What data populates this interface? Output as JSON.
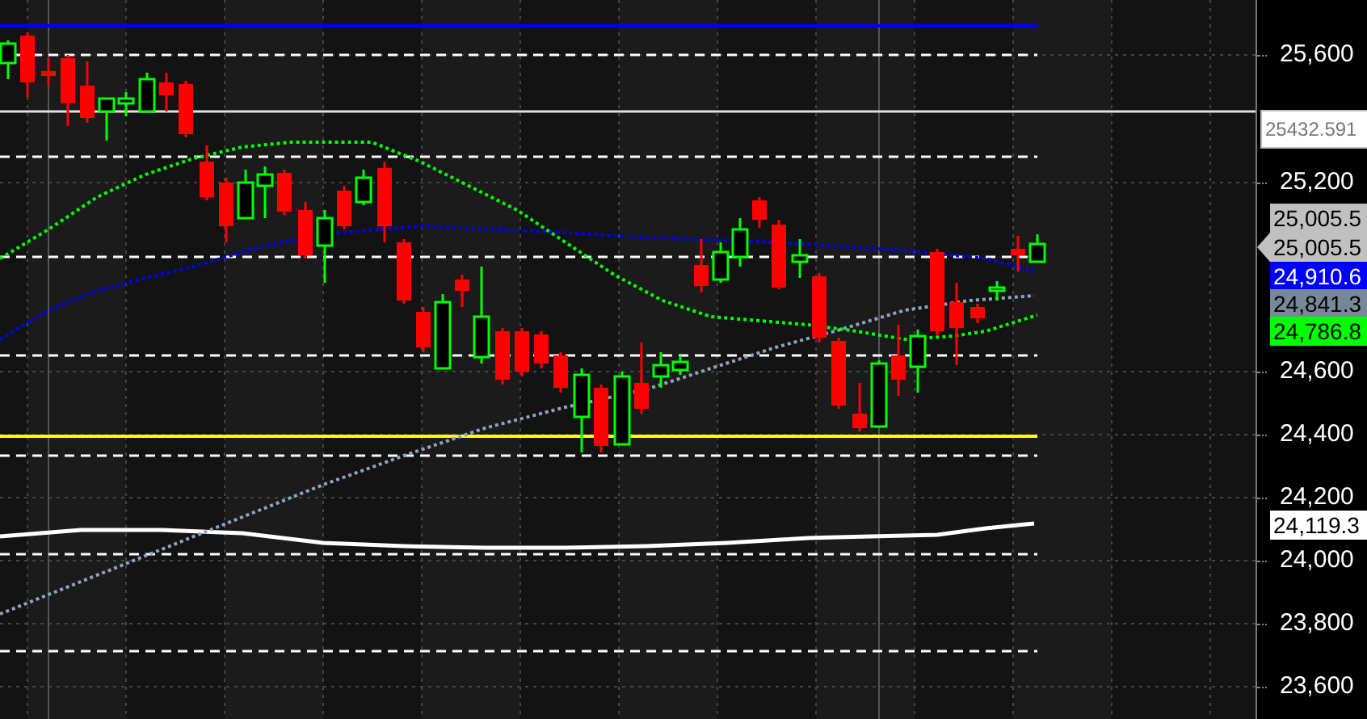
{
  "y_axis": {
    "ticks": [
      "25,600",
      "25,200",
      "24,600",
      "24,400",
      "24,200",
      "24,000",
      "23,800",
      "23,600"
    ]
  },
  "price_labels": [
    {
      "text": "25432.591",
      "color": "#ffffff",
      "kind": "line"
    },
    {
      "text": "25,005.5",
      "color": "#c0c0c0",
      "kind": "plain"
    },
    {
      "text": "25,005.5",
      "color": "#c0c0c0",
      "kind": "pointer"
    },
    {
      "text": "24,910.6",
      "color": "#0000ff",
      "kind": "plain"
    },
    {
      "text": "24,841.3",
      "color": "#778899",
      "kind": "plain"
    },
    {
      "text": "24,786.8",
      "color": "#00ff00",
      "kind": "plain"
    },
    {
      "text": "24,119.3",
      "color": "#ffffff",
      "kind": "plain"
    }
  ]
}
